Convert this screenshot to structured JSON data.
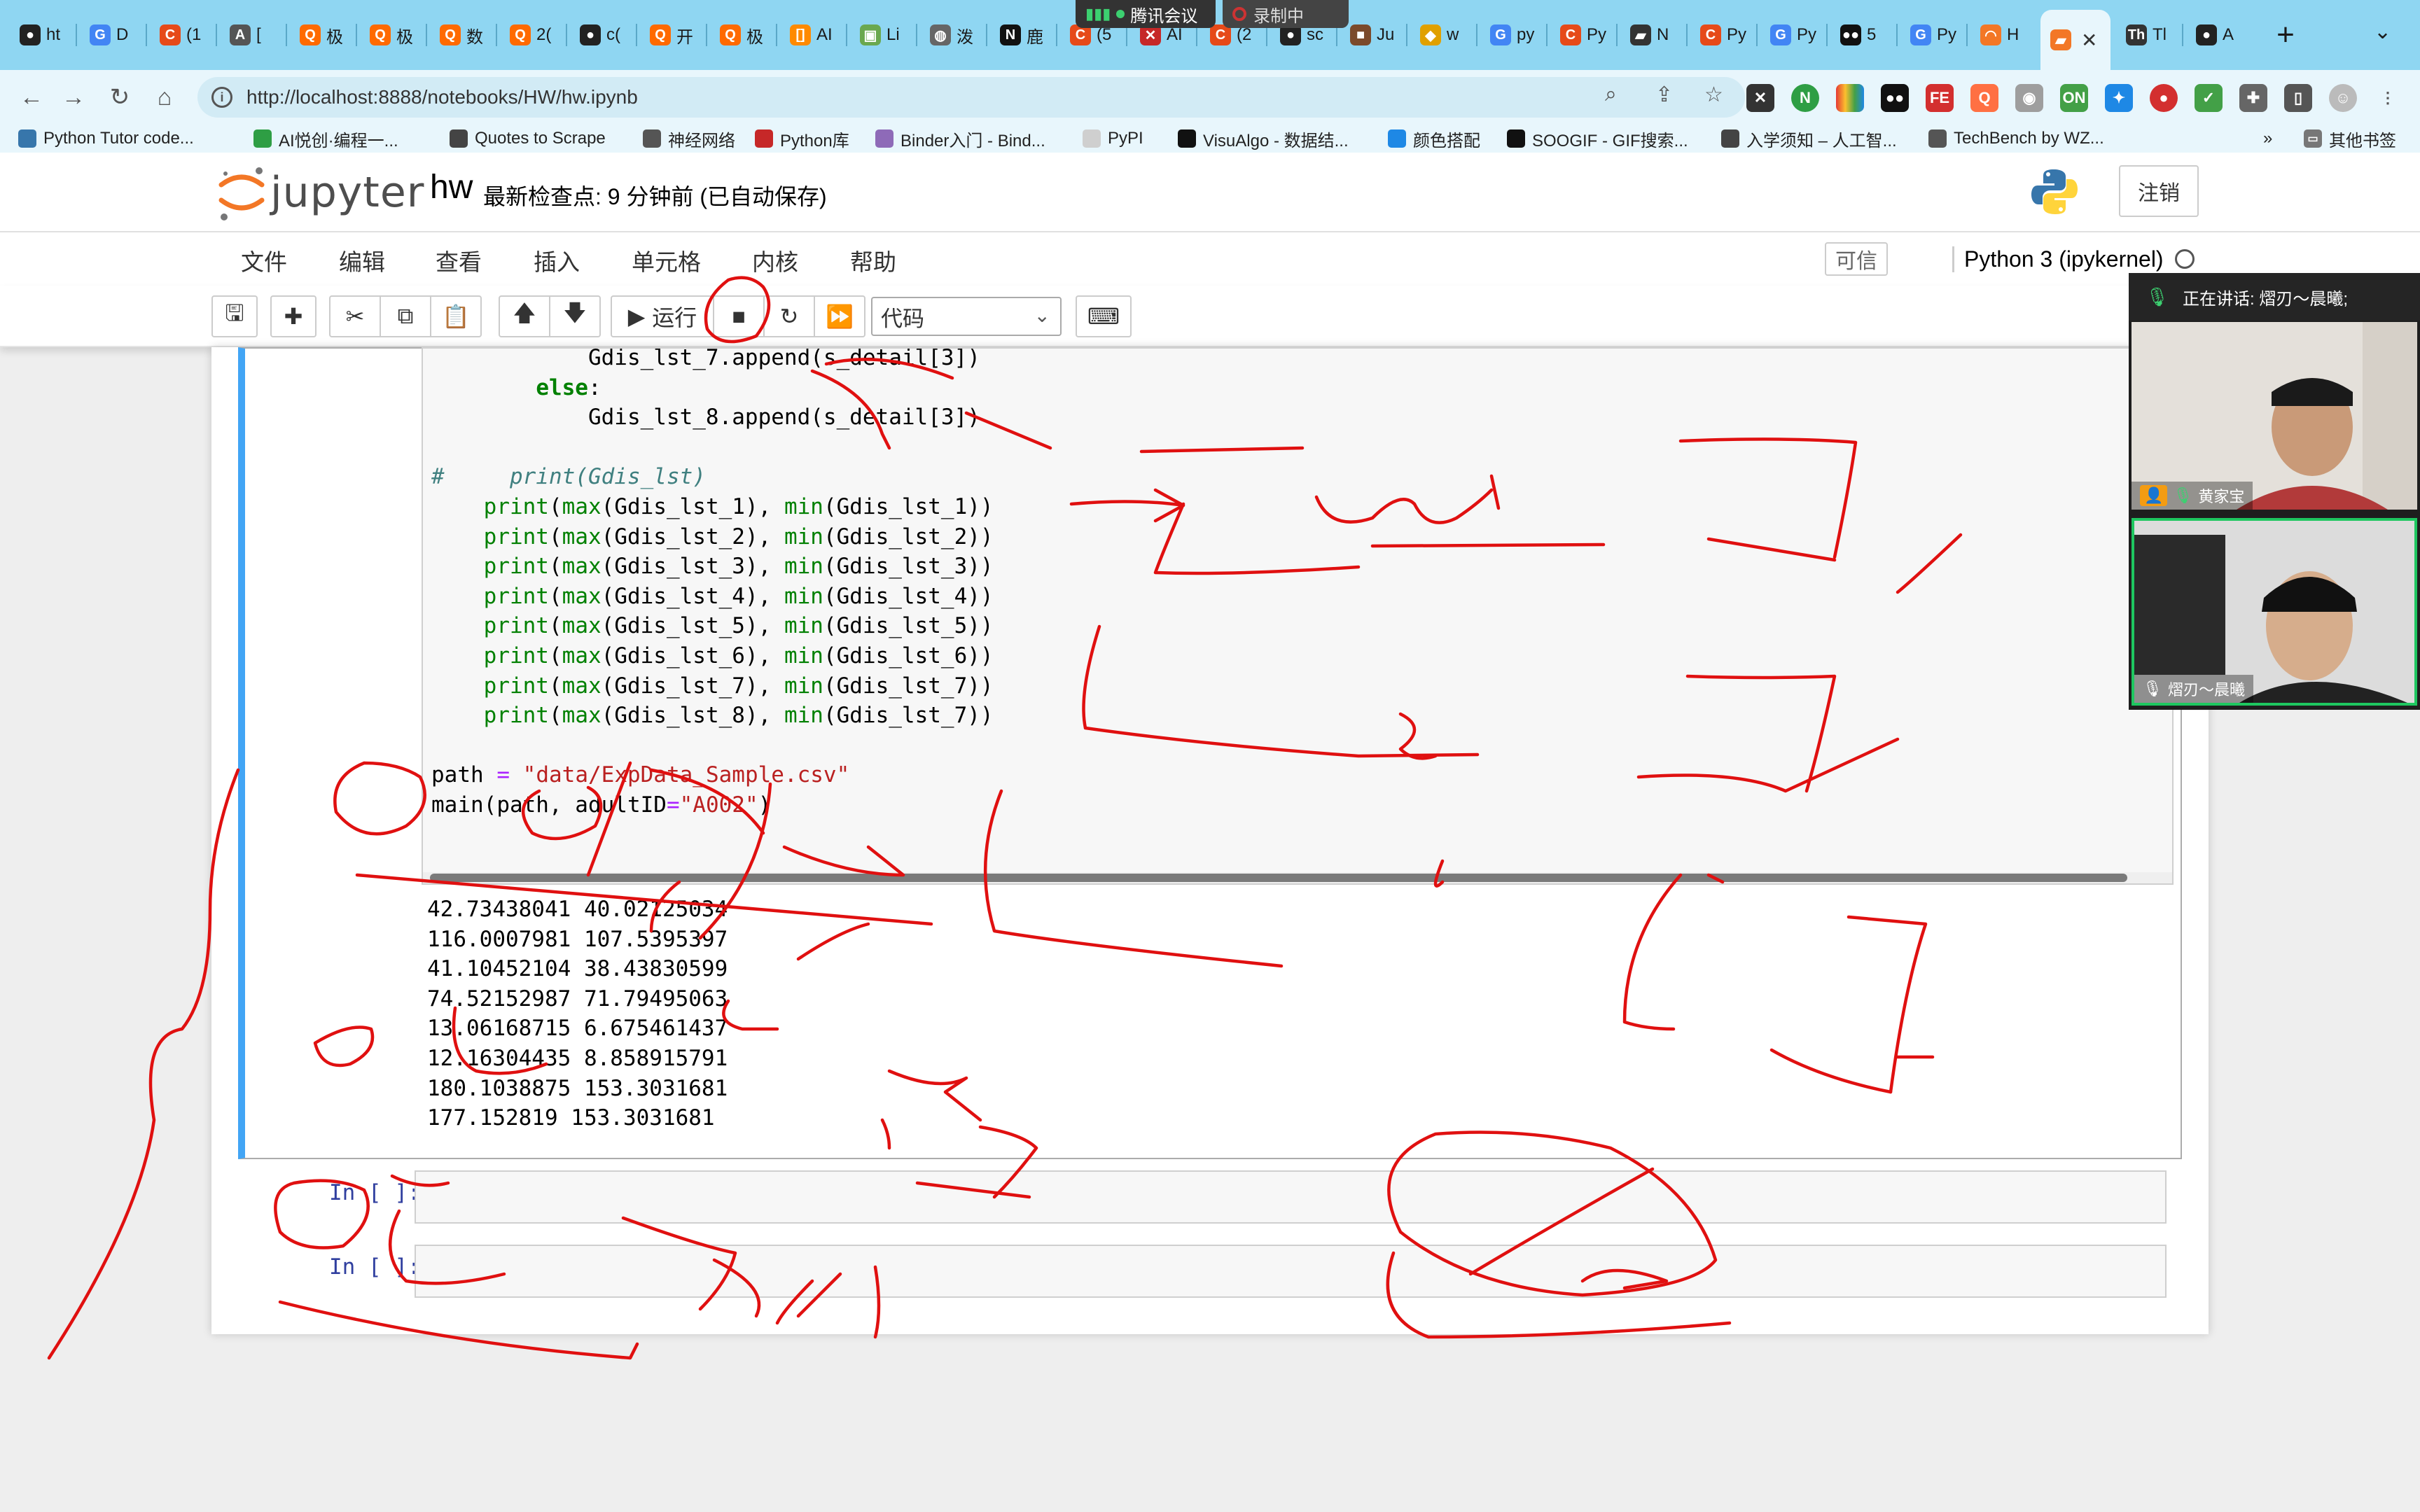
{
  "browser": {
    "tabs": [
      {
        "icon": "github-icon",
        "label": "ht",
        "color": "#222222",
        "glyph": "●"
      },
      {
        "icon": "google-icon",
        "label": "D",
        "color": "#4285f4",
        "glyph": "G"
      },
      {
        "icon": "csdn-icon",
        "label": "(1",
        "color": "#e64a19",
        "glyph": "C"
      },
      {
        "icon": "site-icon",
        "label": "[",
        "color": "#555555",
        "glyph": "A"
      },
      {
        "icon": "zhihu-icon",
        "label": "极",
        "color": "#ff6a00",
        "glyph": "Q"
      },
      {
        "icon": "zhihu-icon",
        "label": "极",
        "color": "#ff6a00",
        "glyph": "Q"
      },
      {
        "icon": "zhihu-icon",
        "label": "数",
        "color": "#ff6a00",
        "glyph": "Q"
      },
      {
        "icon": "zhihu-icon",
        "label": "2(",
        "color": "#ff6a00",
        "glyph": "Q"
      },
      {
        "icon": "github-icon",
        "label": "c(",
        "color": "#222222",
        "glyph": "●"
      },
      {
        "icon": "zhihu-icon",
        "label": "开",
        "color": "#ff6a00",
        "glyph": "Q"
      },
      {
        "icon": "zhihu-icon",
        "label": "极",
        "color": "#ff6a00",
        "glyph": "Q"
      },
      {
        "icon": "ai-icon",
        "label": "AI",
        "color": "#ff8a00",
        "glyph": "[]"
      },
      {
        "icon": "doc-icon",
        "label": "Li",
        "color": "#6aa84f",
        "glyph": "▣"
      },
      {
        "icon": "globe-icon",
        "label": "泼",
        "color": "#666666",
        "glyph": "◍"
      },
      {
        "icon": "notion-icon",
        "label": "鹿",
        "color": "#111111",
        "glyph": "N"
      },
      {
        "icon": "csdn-icon",
        "label": "(5",
        "color": "#e64a19",
        "glyph": "C"
      },
      {
        "icon": "x-icon",
        "label": "AI",
        "color": "#c62828",
        "glyph": "✕"
      },
      {
        "icon": "csdn-icon",
        "label": "(2",
        "color": "#e64a19",
        "glyph": "C"
      },
      {
        "icon": "github-icon",
        "label": "sc",
        "color": "#222222",
        "glyph": "●"
      },
      {
        "icon": "site-icon",
        "label": "Ju",
        "color": "#7b4a2b",
        "glyph": "■"
      },
      {
        "icon": "site-icon",
        "label": "w",
        "color": "#e0a000",
        "glyph": "◆"
      },
      {
        "icon": "google-icon",
        "label": "py",
        "color": "#4285f4",
        "glyph": "G"
      },
      {
        "icon": "csdn-icon",
        "label": "Py",
        "color": "#e64a19",
        "glyph": "C"
      },
      {
        "icon": "book-icon",
        "label": "N",
        "color": "#333333",
        "glyph": "▰"
      },
      {
        "icon": "csdn-icon",
        "label": "Py",
        "color": "#e64a19",
        "glyph": "C"
      },
      {
        "icon": "google-icon",
        "label": "Py",
        "color": "#4285f4",
        "glyph": "G"
      },
      {
        "icon": "flickr-icon",
        "label": "5",
        "color": "#111111",
        "glyph": "●●"
      },
      {
        "icon": "google-icon",
        "label": "Py",
        "color": "#4285f4",
        "glyph": "G"
      },
      {
        "icon": "jupyter-icon",
        "label": "H",
        "color": "#f37726",
        "glyph": "◠"
      },
      {
        "icon": "jupyter-notebook-icon",
        "label": "",
        "color": "#f37726",
        "glyph": "▰",
        "active": true
      },
      {
        "icon": "site-icon",
        "label": "Tl",
        "color": "#333333",
        "glyph": "Th"
      },
      {
        "icon": "github-icon",
        "label": "A",
        "color": "#222222",
        "glyph": "●"
      }
    ],
    "meeting_indicator": "腾讯会议",
    "recording_indicator": "录制中",
    "url": "http://localhost:8888/notebooks/HW/hw.ipynb",
    "bookmarks": [
      {
        "label": "Python Tutor code...",
        "icon": "python-icon",
        "color": "#3776ab"
      },
      {
        "label": "AI悦创·编程一...",
        "icon": "leaf-icon",
        "color": "#2e9e44"
      },
      {
        "label": "Quotes to Scrape",
        "icon": "globe-icon",
        "color": "#444444"
      },
      {
        "label": "神经网络",
        "icon": "grid-icon",
        "color": "#555555"
      },
      {
        "label": "Python库",
        "icon": "x-circle-icon",
        "color": "#c62828"
      },
      {
        "label": "Binder入门 - Bind...",
        "icon": "binder-icon",
        "color": "#8e6ab8"
      },
      {
        "label": "PyPI",
        "icon": "pypi-icon",
        "color": "#cfcfcf"
      },
      {
        "label": "VisuAlgo - 数据结...",
        "icon": "visualgo-icon",
        "color": "#111111"
      },
      {
        "label": "颜色搭配",
        "icon": "c-icon",
        "color": "#1e88e5"
      },
      {
        "label": "SOOGIF - GIF搜索...",
        "icon": "soogif-icon",
        "color": "#111111"
      },
      {
        "label": "入学须知 – 人工智...",
        "icon": "grad-icon",
        "color": "#444444"
      },
      {
        "label": "TechBench by WZ...",
        "icon": "windows-icon",
        "color": "#555555"
      }
    ],
    "bookmarks_more": "»",
    "other_bookmarks": "其他书签"
  },
  "jupyter": {
    "logo_text": "jupyter",
    "notebook_name": "hw",
    "checkpoint": "最新检查点: 9 分钟前   (已自动保存)",
    "logout": "注销",
    "menu": [
      "文件",
      "编辑",
      "查看",
      "插入",
      "单元格",
      "内核",
      "帮助"
    ],
    "trusted": "可信",
    "kernel": "Python 3 (ipykernel)",
    "run_label": "运行",
    "cell_type": "代码",
    "empty_prompt": "In [ ]:"
  },
  "code_lines": [
    [
      {
        "t": "            Gdis_lst_7.append(s_detail[3])"
      }
    ],
    [
      {
        "t": "        "
      },
      {
        "t": "else",
        "c": "kw"
      },
      {
        "t": ":"
      }
    ],
    [
      {
        "t": "            Gdis_lst_8.append(s_detail[3])"
      }
    ],
    [
      {
        "t": ""
      }
    ],
    [
      {
        "t": "#     print(Gdis_lst)",
        "c": "cm"
      }
    ],
    [
      {
        "t": "    "
      },
      {
        "t": "print",
        "c": "bi"
      },
      {
        "t": "("
      },
      {
        "t": "max",
        "c": "bi"
      },
      {
        "t": "(Gdis_lst_1), "
      },
      {
        "t": "min",
        "c": "bi"
      },
      {
        "t": "(Gdis_lst_1))"
      }
    ],
    [
      {
        "t": "    "
      },
      {
        "t": "print",
        "c": "bi"
      },
      {
        "t": "("
      },
      {
        "t": "max",
        "c": "bi"
      },
      {
        "t": "(Gdis_lst_2), "
      },
      {
        "t": "min",
        "c": "bi"
      },
      {
        "t": "(Gdis_lst_2))"
      }
    ],
    [
      {
        "t": "    "
      },
      {
        "t": "print",
        "c": "bi"
      },
      {
        "t": "("
      },
      {
        "t": "max",
        "c": "bi"
      },
      {
        "t": "(Gdis_lst_3), "
      },
      {
        "t": "min",
        "c": "bi"
      },
      {
        "t": "(Gdis_lst_3))"
      }
    ],
    [
      {
        "t": "    "
      },
      {
        "t": "print",
        "c": "bi"
      },
      {
        "t": "("
      },
      {
        "t": "max",
        "c": "bi"
      },
      {
        "t": "(Gdis_lst_4), "
      },
      {
        "t": "min",
        "c": "bi"
      },
      {
        "t": "(Gdis_lst_4))"
      }
    ],
    [
      {
        "t": "    "
      },
      {
        "t": "print",
        "c": "bi"
      },
      {
        "t": "("
      },
      {
        "t": "max",
        "c": "bi"
      },
      {
        "t": "(Gdis_lst_5), "
      },
      {
        "t": "min",
        "c": "bi"
      },
      {
        "t": "(Gdis_lst_5))"
      }
    ],
    [
      {
        "t": "    "
      },
      {
        "t": "print",
        "c": "bi"
      },
      {
        "t": "("
      },
      {
        "t": "max",
        "c": "bi"
      },
      {
        "t": "(Gdis_lst_6), "
      },
      {
        "t": "min",
        "c": "bi"
      },
      {
        "t": "(Gdis_lst_6))"
      }
    ],
    [
      {
        "t": "    "
      },
      {
        "t": "print",
        "c": "bi"
      },
      {
        "t": "("
      },
      {
        "t": "max",
        "c": "bi"
      },
      {
        "t": "(Gdis_lst_7), "
      },
      {
        "t": "min",
        "c": "bi"
      },
      {
        "t": "(Gdis_lst_7))"
      }
    ],
    [
      {
        "t": "    "
      },
      {
        "t": "print",
        "c": "bi"
      },
      {
        "t": "("
      },
      {
        "t": "max",
        "c": "bi"
      },
      {
        "t": "(Gdis_lst_8), "
      },
      {
        "t": "min",
        "c": "bi"
      },
      {
        "t": "(Gdis_lst_7))"
      }
    ],
    [
      {
        "t": ""
      }
    ],
    [
      {
        "t": "path "
      },
      {
        "t": "=",
        "c": "op"
      },
      {
        "t": " "
      },
      {
        "t": "\"data/ExpData_Sample.csv\"",
        "c": "st"
      }
    ],
    [
      {
        "t": "main(path, adultID"
      },
      {
        "t": "=",
        "c": "op"
      },
      {
        "t": "\"A002\"",
        "c": "st"
      },
      {
        "t": ")"
      }
    ]
  ],
  "output_lines": [
    "42.73438041 40.02125034",
    "116.0007981 107.5395397",
    "41.10452104 38.43830599",
    "74.52152987 71.79495063",
    "13.06168715 6.675461437",
    "12.16304435 8.858915791",
    "180.1038875 153.3031681",
    "177.152819 153.3031681"
  ],
  "call": {
    "speaking": "正在讲话: 熠刃～晨曦;",
    "participant_1": "黄家宝",
    "participant_2": "熠刃～晨曦"
  }
}
